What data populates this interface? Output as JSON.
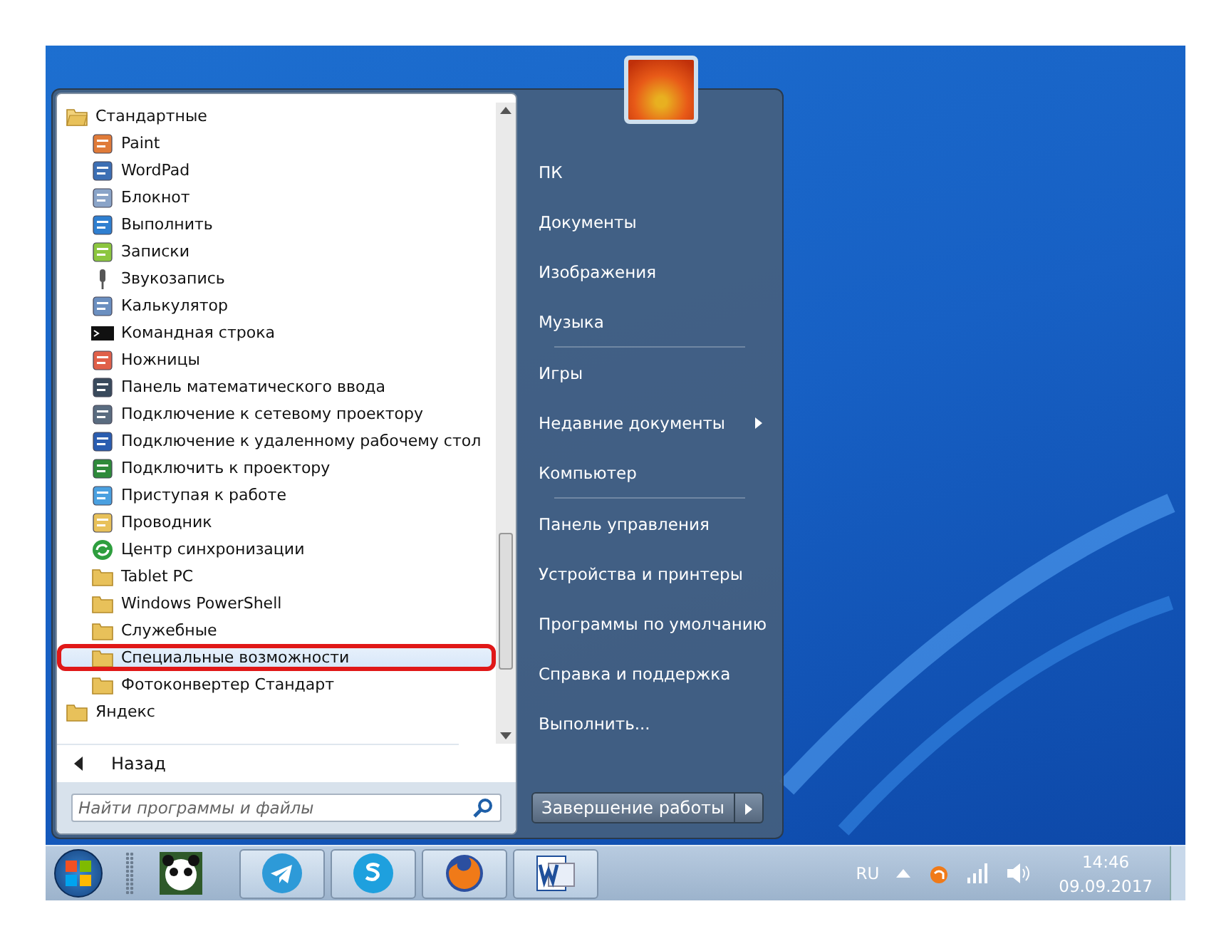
{
  "start_menu": {
    "programs": [
      {
        "label": "Стандартные",
        "kind": "folder",
        "expanded": true,
        "selected": false,
        "callout": false,
        "children": [
          {
            "label": "Paint",
            "kind": "paint",
            "selected": false,
            "callout": false
          },
          {
            "label": "WordPad",
            "kind": "document",
            "selected": false,
            "callout": false
          },
          {
            "label": "Блокнот",
            "kind": "notepad",
            "selected": false,
            "callout": false
          },
          {
            "label": "Выполнить",
            "kind": "run",
            "selected": false,
            "callout": false
          },
          {
            "label": "Записки",
            "kind": "notes",
            "selected": false,
            "callout": false
          },
          {
            "label": "Звукозапись",
            "kind": "microphone",
            "selected": false,
            "callout": false
          },
          {
            "label": "Калькулятор",
            "kind": "calculator",
            "selected": false,
            "callout": false
          },
          {
            "label": "Командная строка",
            "kind": "console",
            "selected": false,
            "callout": false
          },
          {
            "label": "Ножницы",
            "kind": "scissors",
            "selected": false,
            "callout": false
          },
          {
            "label": "Панель математического ввода",
            "kind": "pen",
            "selected": false,
            "callout": false
          },
          {
            "label": "Подключение к сетевому проектору",
            "kind": "projector",
            "selected": false,
            "callout": false
          },
          {
            "label": "Подключение к удаленному рабочему стол",
            "kind": "remote",
            "selected": false,
            "callout": false
          },
          {
            "label": "Подключить к проектору",
            "kind": "monitor",
            "selected": false,
            "callout": false
          },
          {
            "label": "Приступая к работе",
            "kind": "getting-started",
            "selected": false,
            "callout": false
          },
          {
            "label": "Проводник",
            "kind": "explorer",
            "selected": false,
            "callout": false
          },
          {
            "label": "Центр синхронизации",
            "kind": "sync",
            "selected": false,
            "callout": false
          },
          {
            "label": "Tablet PC",
            "kind": "folder",
            "selected": false,
            "callout": false
          },
          {
            "label": "Windows PowerShell",
            "kind": "folder",
            "selected": false,
            "callout": false
          },
          {
            "label": "Служебные",
            "kind": "folder",
            "selected": false,
            "callout": false
          },
          {
            "label": "Специальные возможности",
            "kind": "folder",
            "selected": true,
            "callout": true
          },
          {
            "label": "Фотоконвертер Стандарт",
            "kind": "folder",
            "selected": false,
            "callout": false
          }
        ]
      },
      {
        "label": "Яндекс",
        "kind": "folder",
        "expanded": false,
        "selected": false,
        "callout": false
      }
    ],
    "back": {
      "label": "Назад"
    },
    "search": {
      "placeholder": "Найти программы и файлы"
    },
    "places": [
      [
        {
          "label": "ПК",
          "submenu": false
        },
        {
          "label": "Документы",
          "submenu": false
        },
        {
          "label": "Изображения",
          "submenu": false
        },
        {
          "label": "Музыка",
          "submenu": false
        }
      ],
      [
        {
          "label": "Игры",
          "submenu": false
        },
        {
          "label": "Недавние документы",
          "submenu": true
        },
        {
          "label": "Компьютер",
          "submenu": false
        }
      ],
      [
        {
          "label": "Панель управления",
          "submenu": false
        },
        {
          "label": "Устройства и принтеры",
          "submenu": false
        },
        {
          "label": "Программы по умолчанию",
          "submenu": false
        },
        {
          "label": "Справка и поддержка",
          "submenu": false
        },
        {
          "label": "Выполнить...",
          "submenu": false
        }
      ]
    ],
    "shutdown": {
      "label": "Завершение работы"
    }
  },
  "taskbar": {
    "apps": [
      {
        "kind": "panda"
      },
      {
        "kind": "telegram"
      },
      {
        "kind": "skype"
      },
      {
        "kind": "firefox"
      },
      {
        "kind": "word"
      }
    ],
    "language": "RU",
    "time": "14:46",
    "date": "09.09.2017"
  }
}
